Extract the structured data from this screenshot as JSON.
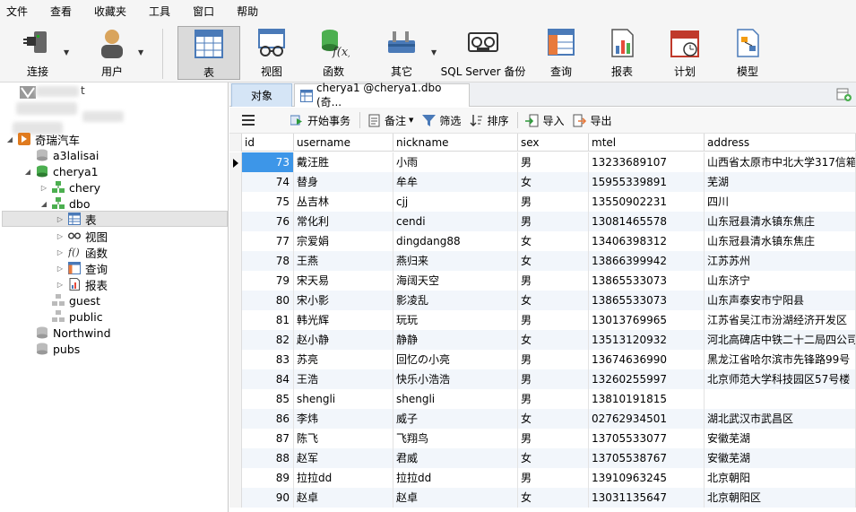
{
  "menu": [
    "文件",
    "查看",
    "收藏夹",
    "工具",
    "窗口",
    "帮助"
  ],
  "toolbar": {
    "connect": "连接",
    "user": "用户",
    "table": "表",
    "view": "视图",
    "function": "函数",
    "other": "其它",
    "sqlserver_backup": "SQL Server 备份",
    "query": "查询",
    "report": "报表",
    "schedule": "计划",
    "model": "模型"
  },
  "tree": {
    "top_partial": "t",
    "conn": "奇瑞汽车",
    "dbs": [
      "a3lalisai",
      "cherya1"
    ],
    "schema_chery": "chery",
    "schema_dbo": "dbo",
    "dbo_items": [
      "表",
      "视图",
      "函数",
      "查询",
      "报表"
    ],
    "schemas_more": [
      "guest",
      "public"
    ],
    "other_dbs": [
      "Northwind",
      "pubs"
    ]
  },
  "tabs": {
    "objects": "对象",
    "table_tab": "cherya1 @cherya1.dbo (奇..."
  },
  "subtoolbar": {
    "begin_tx": "开始事务",
    "note": "备注",
    "filter": "筛选",
    "sort": "排序",
    "import": "导入",
    "export": "导出"
  },
  "grid": {
    "columns": [
      "id",
      "username",
      "nickname",
      "sex",
      "mtel",
      "address"
    ],
    "rows": [
      [
        "73",
        "戴汪胜",
        "小雨",
        "男",
        "13233689107",
        "山西省太原市中北大学317信箱"
      ],
      [
        "74",
        "替身",
        "牟牟",
        "女",
        "15955339891",
        "芜湖"
      ],
      [
        "75",
        "丛吉林",
        "cjj",
        "男",
        "13550902231",
        "四川"
      ],
      [
        "76",
        "常化利",
        "cendi",
        "男",
        "13081465578",
        "山东冠县清水镇东焦庄"
      ],
      [
        "77",
        "宗爱娟",
        "dingdang88",
        "女",
        "13406398312",
        "山东冠县清水镇东焦庄"
      ],
      [
        "78",
        "王燕",
        "燕归来",
        "女",
        "13866399942",
        "江苏苏州"
      ],
      [
        "79",
        "宋天易",
        "海阔天空",
        "男",
        "13865533073",
        "山东济宁"
      ],
      [
        "80",
        "宋小影",
        "影凌乱",
        "女",
        "13865533073",
        "山东声泰安市宁阳县"
      ],
      [
        "81",
        "韩光辉",
        "玩玩",
        "男",
        "13013769965",
        "江苏省吴江市汾湖经济开发区"
      ],
      [
        "82",
        "赵小静",
        "静静",
        "女",
        "13513120932",
        "河北高碑店中铁二十二局四公司"
      ],
      [
        "83",
        "苏亮",
        "回忆の小亮",
        "男",
        "13674636990",
        "黑龙江省哈尔滨市先锋路99号"
      ],
      [
        "84",
        "王浩",
        "快乐小浩浩",
        "男",
        "13260255997",
        "北京师范大学科技园区57号楼"
      ],
      [
        "85",
        "shengli",
        "shengli",
        "男",
        "13810191815",
        ""
      ],
      [
        "86",
        "李炜",
        "威子",
        "女",
        "02762934501",
        "湖北武汉市武昌区"
      ],
      [
        "87",
        "陈飞",
        "飞翔鸟",
        "男",
        "13705533077",
        "安徽芜湖"
      ],
      [
        "88",
        "赵军",
        "君威",
        "女",
        "13705538767",
        "安徽芜湖"
      ],
      [
        "89",
        "拉拉dd",
        "拉拉dd",
        "男",
        "13910963245",
        "北京朝阳"
      ],
      [
        "90",
        "赵卓",
        "赵卓",
        "女",
        "13031135647",
        "北京朝阳区"
      ]
    ]
  },
  "colors": {
    "accent": "#3d96e8",
    "selected_tab": "#d5e5f6",
    "row_alt": "#f2f6fb"
  }
}
